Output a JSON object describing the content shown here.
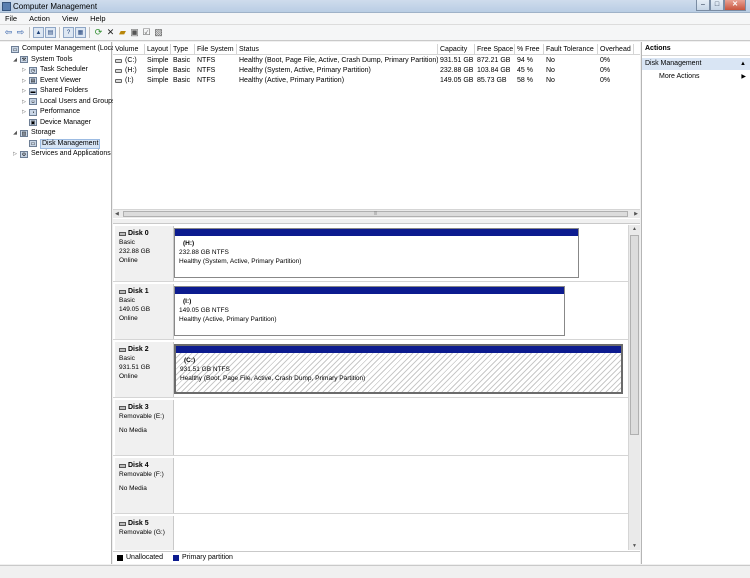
{
  "window": {
    "title": "Computer Management"
  },
  "menu": [
    "File",
    "Action",
    "View",
    "Help"
  ],
  "toolbar_icons": [
    "back-arrow",
    "forward-arrow",
    "up-folder",
    "show-hide-tree",
    "help",
    "properties",
    "refresh",
    "delete",
    "open",
    "save",
    "check-disk"
  ],
  "tree": [
    {
      "label": "Computer Management (Local",
      "level": 0,
      "expander": "",
      "icon": "computer-icon"
    },
    {
      "label": "System Tools",
      "level": 1,
      "expander": "◢",
      "icon": "toolbox-icon"
    },
    {
      "label": "Task Scheduler",
      "level": 2,
      "expander": "▷",
      "icon": "clock-icon"
    },
    {
      "label": "Event Viewer",
      "level": 2,
      "expander": "▷",
      "icon": "event-viewer-icon"
    },
    {
      "label": "Shared Folders",
      "level": 2,
      "expander": "▷",
      "icon": "folder-icon"
    },
    {
      "label": "Local Users and Groups",
      "level": 2,
      "expander": "▷",
      "icon": "users-icon"
    },
    {
      "label": "Performance",
      "level": 2,
      "expander": "▷",
      "icon": "performance-icon"
    },
    {
      "label": "Device Manager",
      "level": 2,
      "expander": "",
      "icon": "device-manager-icon"
    },
    {
      "label": "Storage",
      "level": 1,
      "expander": "◢",
      "icon": "storage-icon"
    },
    {
      "label": "Disk Management",
      "level": 2,
      "expander": "",
      "icon": "disk-icon",
      "selected": true
    },
    {
      "label": "Services and Applications",
      "level": 1,
      "expander": "▷",
      "icon": "services-icon"
    }
  ],
  "volume_table": {
    "columns": [
      "Volume",
      "Layout",
      "Type",
      "File System",
      "Status",
      "Capacity",
      "Free Space",
      "% Free",
      "Fault Tolerance",
      "Overhead"
    ],
    "rows": [
      [
        "(C:)",
        "Simple",
        "Basic",
        "NTFS",
        "Healthy (Boot, Page File, Active, Crash Dump, Primary Partition)",
        "931.51 GB",
        "872.21 GB",
        "94 %",
        "No",
        "0%"
      ],
      [
        "(H:)",
        "Simple",
        "Basic",
        "NTFS",
        "Healthy (System, Active, Primary Partition)",
        "232.88 GB",
        "103.84 GB",
        "45 %",
        "No",
        "0%"
      ],
      [
        "(I:)",
        "Simple",
        "Basic",
        "NTFS",
        "Healthy (Active, Primary Partition)",
        "149.05 GB",
        "85.73 GB",
        "58 %",
        "No",
        "0%"
      ]
    ]
  },
  "disks": [
    {
      "name": "Disk 0",
      "type": "Basic",
      "size": "232.88 GB",
      "state": "Online",
      "partition": {
        "label": "(H:)",
        "size": "232.88 GB NTFS",
        "status": "Healthy (System, Active, Primary Partition)"
      }
    },
    {
      "name": "Disk 1",
      "type": "Basic",
      "size": "149.05 GB",
      "state": "Online",
      "partition": {
        "label": "(I:)",
        "size": "149.05 GB NTFS",
        "status": "Healthy (Active, Primary Partition)"
      }
    },
    {
      "name": "Disk 2",
      "type": "Basic",
      "size": "931.51 GB",
      "state": "Online",
      "partition": {
        "label": "(C:)",
        "size": "931.51 GB NTFS",
        "status": "Healthy (Boot, Page File, Active, Crash Dump, Primary Partition)"
      }
    },
    {
      "name": "Disk 3",
      "type": "Removable (E:)",
      "size": "",
      "state": "No Media"
    },
    {
      "name": "Disk 4",
      "type": "Removable (F:)",
      "size": "",
      "state": "No Media"
    },
    {
      "name": "Disk 5",
      "type": "Removable (G:)",
      "size": "",
      "state": ""
    }
  ],
  "legend": [
    {
      "label": "Unallocated",
      "color": "#000000"
    },
    {
      "label": "Primary partition",
      "color": "#0c1b8f"
    }
  ],
  "actions": {
    "header": "Actions",
    "section": "Disk Management",
    "more": "More Actions"
  }
}
